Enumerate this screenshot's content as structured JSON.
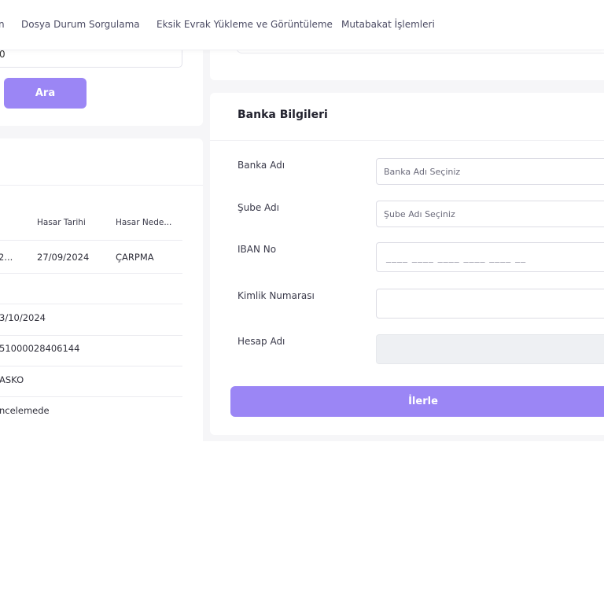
{
  "nav": {
    "items": [
      {
        "label": "n"
      },
      {
        "label": "Dosya Durum Sorgulama"
      },
      {
        "label": "Eksik Evrak Yükleme ve Görüntüleme"
      },
      {
        "label": "Mutabakat İşlemleri"
      }
    ]
  },
  "search": {
    "value": "0",
    "button_label": "Ara"
  },
  "results": {
    "columns": [
      "Hasar Tarihi",
      "Hasar Nede..."
    ],
    "row": {
      "cell_0": "2...",
      "hasar_tarihi": "27/09/2024",
      "hasar_nedeni": "ÇARPMA"
    },
    "details": [
      "3/10/2024",
      "51000028406144",
      "ASKO",
      "ncelemede"
    ]
  },
  "bank": {
    "title": "Banka Bilgileri",
    "fields": {
      "banka_adi": {
        "label": "Banka Adı",
        "placeholder": "Banka Adı Seçiniz"
      },
      "sube_adi": {
        "label": "Şube Adı",
        "placeholder": "Şube Adı Seçiniz"
      },
      "iban": {
        "label": "IBAN No",
        "mask": "____ ____ ____ ____ ____ __"
      },
      "kimlik": {
        "label": "Kimlik Numarası",
        "value": ""
      },
      "hesap_adi": {
        "label": "Hesap Adı",
        "value": ""
      }
    },
    "submit_label": "İlerle"
  },
  "colors": {
    "accent": "#9b86f5",
    "background": "#f6f6f8"
  }
}
